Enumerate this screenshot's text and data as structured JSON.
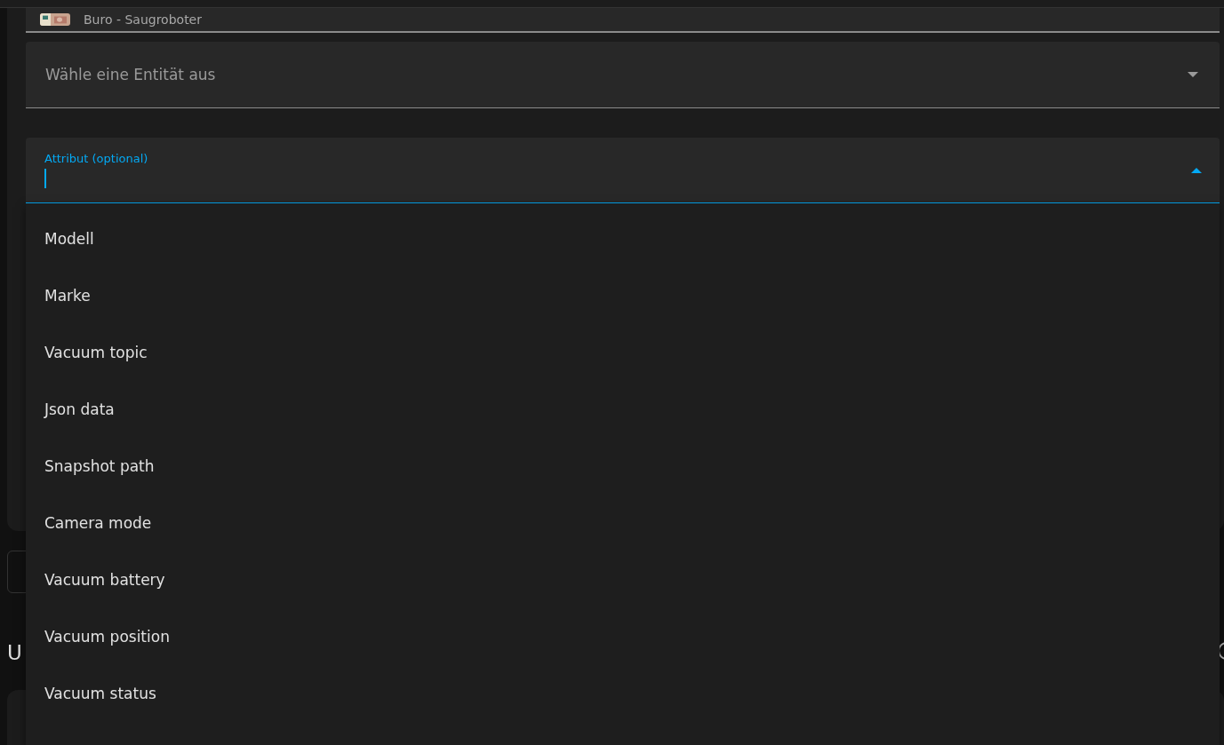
{
  "entity_row": {
    "name": "Buro - Saugroboter",
    "kind": "picture"
  },
  "entity_select": {
    "placeholder": "Wähle eine Entität aus",
    "expanded": false
  },
  "attribute_field": {
    "label": "Attribut (optional)",
    "expanded": true
  },
  "menu": {
    "items": [
      {
        "label": "Modell"
      },
      {
        "label": "Marke"
      },
      {
        "label": "Vacuum topic"
      },
      {
        "label": "Json data"
      },
      {
        "label": "Snapshot path"
      },
      {
        "label": "Camera mode"
      },
      {
        "label": "Vacuum battery"
      },
      {
        "label": "Vacuum position"
      },
      {
        "label": "Vacuum status"
      }
    ]
  },
  "section_heading": "U"
}
